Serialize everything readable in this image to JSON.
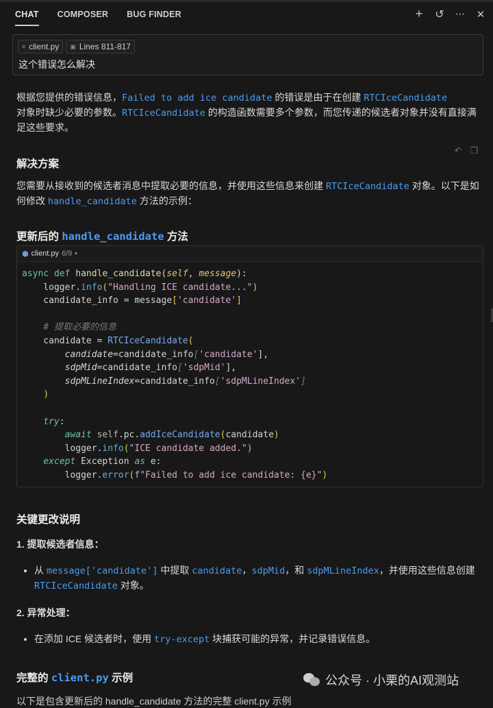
{
  "tabs": [
    {
      "label": "CHAT"
    },
    {
      "label": "COMPOSER"
    },
    {
      "label": "BUG FINDER"
    }
  ],
  "header_icons": [
    "plus-icon",
    "history-icon",
    "more-icon",
    "close-icon"
  ],
  "input": {
    "chips": [
      {
        "icon": "file-icon",
        "label": "client.py"
      },
      {
        "icon": "terminal-icon",
        "label": "Lines 811-817"
      }
    ],
    "query": "这个错误怎么解决"
  },
  "answer": {
    "intro": {
      "t1": "根据您提供的错误信息，",
      "c1": "Failed to add ice candidate",
      "t2": " 的错误是由于在创建 ",
      "c2": "RTCIceCandidate",
      "t3": "对象时缺少必要的参数。",
      "c3": "RTCIceCandidate",
      "t4": " 的构造函数需要多个参数，而您传递的候选者对象并没有直接满足这些要求。"
    },
    "solution_heading": "解决方案",
    "solution": {
      "t1": "您需要从接收到的候选者消息中提取必要的信息，并使用这些信息来创建 ",
      "c1": "RTCIceCandidate",
      "t2": " 对象。以下是如何修改 ",
      "c2": "handle_candidate",
      "t3": " 方法的示例："
    },
    "updated_heading": {
      "t1": "更新后的 ",
      "c1": "handle_candidate",
      "t2": " 方法"
    },
    "code_block": {
      "filename": "client.py",
      "count": "6/9",
      "dot": "•",
      "lines": [
        [
          [
            "async def ",
            "kw"
          ],
          [
            "handle_candidate",
            "fn"
          ],
          [
            "(",
            "fn"
          ],
          [
            "self",
            "pa"
          ],
          [
            ", ",
            ""
          ],
          [
            "message",
            "pa"
          ],
          [
            "):",
            ""
          ]
        ],
        [
          [
            "    logger.",
            ""
          ],
          [
            "info",
            "me"
          ],
          [
            "(",
            "br"
          ],
          [
            "\"Handling ICE candidate...\"",
            "st"
          ],
          [
            ")",
            "br"
          ]
        ],
        [
          [
            "    candidate_info = message",
            ""
          ],
          [
            "[",
            "br"
          ],
          [
            "'candidate'",
            "st"
          ],
          [
            "]",
            "br"
          ]
        ],
        [
          [
            "",
            ""
          ]
        ],
        [
          [
            "    # 提取必要的信息",
            "cm"
          ]
        ],
        [
          [
            "    candidate = ",
            ""
          ],
          [
            "RTCIceCandidate",
            "cl"
          ],
          [
            "(",
            "br"
          ]
        ],
        [
          [
            "        ",
            ""
          ],
          [
            "candidate",
            "kp"
          ],
          [
            "=candidate_info",
            ""
          ],
          [
            "[",
            "cm"
          ],
          [
            "'candidate'",
            "st"
          ],
          [
            "],",
            ""
          ]
        ],
        [
          [
            "        ",
            ""
          ],
          [
            "sdpMid",
            "kp"
          ],
          [
            "=candidate_info",
            ""
          ],
          [
            "[",
            "cm"
          ],
          [
            "'sdpMid'",
            "st"
          ],
          [
            "],",
            ""
          ]
        ],
        [
          [
            "        ",
            ""
          ],
          [
            "sdpMLineIndex",
            "kp"
          ],
          [
            "=candidate_info",
            ""
          ],
          [
            "[",
            "cm"
          ],
          [
            "'sdpMLineIndex'",
            "st"
          ],
          [
            "]",
            "cm"
          ]
        ],
        [
          [
            "    ",
            ""
          ],
          [
            ")",
            "br"
          ]
        ],
        [
          [
            "",
            ""
          ]
        ],
        [
          [
            "    ",
            ""
          ],
          [
            "try",
            "ik"
          ],
          [
            ":",
            ""
          ]
        ],
        [
          [
            "        ",
            ""
          ],
          [
            "await ",
            "ik"
          ],
          [
            "self",
            "sf"
          ],
          [
            ".pc.",
            ""
          ],
          [
            "addIceCandidate",
            "cl"
          ],
          [
            "(",
            "br"
          ],
          [
            "candidate",
            ""
          ],
          [
            ")",
            "br"
          ]
        ],
        [
          [
            "        logger.",
            ""
          ],
          [
            "info",
            "me"
          ],
          [
            "(",
            "br"
          ],
          [
            "\"ICE candidate added.\"",
            "st"
          ],
          [
            ")",
            "br"
          ]
        ],
        [
          [
            "    ",
            ""
          ],
          [
            "except",
            "ik"
          ],
          [
            " Exception ",
            ""
          ],
          [
            "as",
            "ik"
          ],
          [
            " e:",
            ""
          ]
        ],
        [
          [
            "        logger.",
            ""
          ],
          [
            "error",
            "me"
          ],
          [
            "(",
            "br"
          ],
          [
            "f\"Failed to add ice candidate: {e}\"",
            "st"
          ],
          [
            ")",
            "br"
          ]
        ]
      ]
    },
    "key_changes_heading": "关键更改说明",
    "item1_title": "1. 提取候选者信息：",
    "item1": {
      "t1": "从 ",
      "c1": "message['candidate']",
      "t2": " 中提取 ",
      "c2": "candidate",
      "t3": "，",
      "c3": "sdpMid",
      "t4": "，和 ",
      "c4": "sdpMLineIndex",
      "t5": "，并使用这些信息创建 ",
      "c5": "RTCIceCandidate",
      "t6": " 对象。"
    },
    "item2_title": "2. 异常处理：",
    "item2": {
      "t1": "在添加 ICE 候选者时，使用 ",
      "c1": "try-except",
      "t2": " 块捕获可能的异常，并记录错误信息。"
    },
    "full_heading": {
      "t1": "完整的 ",
      "c1": "client.py",
      "t2": " 示例"
    },
    "cut_line": "以下是包含更新后的 handle_candidate 方法的完整 client.py 示例"
  },
  "message_icons": [
    "undo-icon",
    "copy-icon"
  ],
  "watermark": "公众号 · 小栗的AI观测站"
}
